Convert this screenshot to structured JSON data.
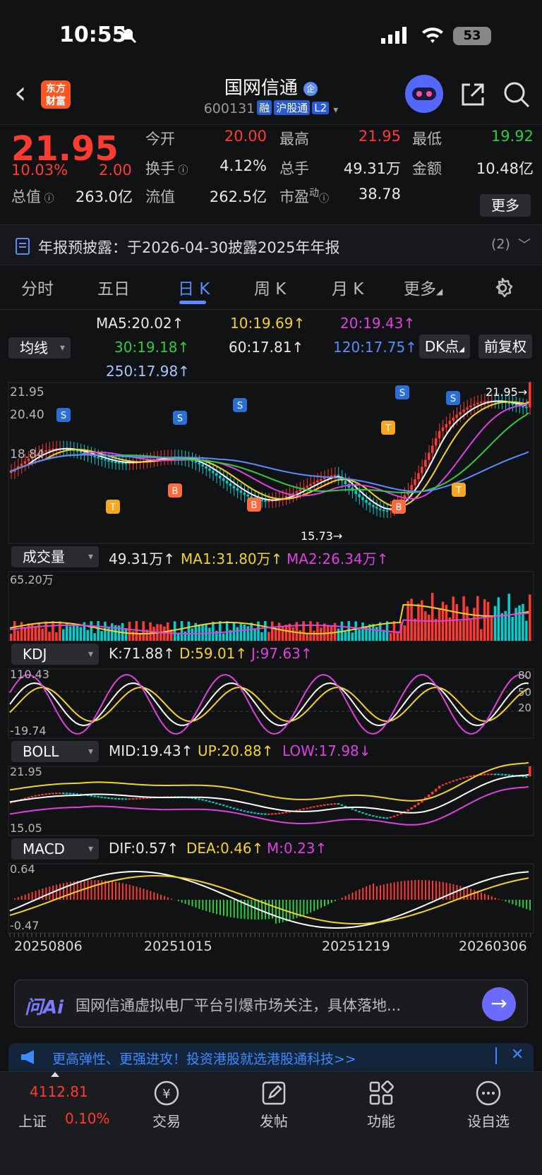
{
  "status": {
    "time": "10:55",
    "battery": "53"
  },
  "header": {
    "title": "国网信通",
    "code": "600131",
    "tags": [
      "融",
      "沪股通",
      "L2"
    ],
    "logo": "东方\n财富"
  },
  "quote": {
    "price": "21.95",
    "pct": "10.03%",
    "chg": "2.00",
    "open_label": "今开",
    "open": "20.00",
    "high_label": "最高",
    "high": "21.95",
    "low_label": "最低",
    "low": "19.92",
    "turnover_label": "换手",
    "turnover": "4.12%",
    "vol_label": "总手",
    "vol": "49.31万",
    "amount_label": "金额",
    "amount": "10.48亿",
    "mcap_label": "总值",
    "mcap": "263.0亿",
    "float_label": "流值",
    "float": "262.5亿",
    "pe_label": "市盈",
    "pe_sup": "动",
    "pe": "38.78",
    "more": "更多"
  },
  "notice": {
    "text": "年报预披露：于2026-04-30披露2025年年报",
    "count": "(2)"
  },
  "tabs": [
    "分时",
    "五日",
    "日 K",
    "周 K",
    "月 K",
    "更多"
  ],
  "ma": {
    "selector": "均线",
    "ma5": "MA5:20.02↑",
    "ma10": "10:19.69↑",
    "ma20": "20:19.43↑",
    "ma30": "30:19.18↑",
    "ma60": "60:17.81↑",
    "ma120": "120:17.75↑",
    "ma250": "250:17.98↑",
    "dk": "DK点",
    "fq": "前复权"
  },
  "kchart": {
    "ymax": "21.95",
    "y2": "20.40",
    "y3": "18.84",
    "lowmark": "15.73",
    "highmark": "21.95→"
  },
  "volume": {
    "selector": "成交量",
    "v": "49.31万↑",
    "ma1": "MA1:31.80万↑",
    "ma2": "MA2:26.34万↑",
    "ymax": "65.20万"
  },
  "kdj": {
    "selector": "KDJ",
    "k": "K:71.88↑",
    "d": "D:59.01↑",
    "j": "J:97.63↑",
    "ymax": "110.43",
    "ymin": "-19.74",
    "r80": "80",
    "r50": "50",
    "r20": "20"
  },
  "boll": {
    "selector": "BOLL",
    "mid": "MID:19.43↑",
    "up": "UP:20.88↑",
    "low": "LOW:17.98↓",
    "ymax": "21.95",
    "ymin": "15.05"
  },
  "macd": {
    "selector": "MACD",
    "dif": "DIF:0.57↑",
    "dea": "DEA:0.46↑",
    "m": "M:0.23↑",
    "ymax": "0.64",
    "ymin": "-0.47"
  },
  "dates": [
    "20250806",
    "20251015",
    "20251219",
    "20260306"
  ],
  "ai": {
    "brand": "问Ai",
    "text": "国网信通虚拟电厂平台引爆市场关注，具体落地..."
  },
  "banner": {
    "text": "更高弹性、更强进攻！投资港股就选港股通科技>>"
  },
  "nav": {
    "index_value": "4112.81",
    "index_name": "上证",
    "index_pct": "0.10%",
    "items": [
      "交易",
      "发帖",
      "功能",
      "设自选"
    ]
  },
  "colors": {
    "up": "#ff3b30",
    "down": "#2ecc40",
    "accent": "#5b8cff",
    "brand": "#ff5722"
  }
}
